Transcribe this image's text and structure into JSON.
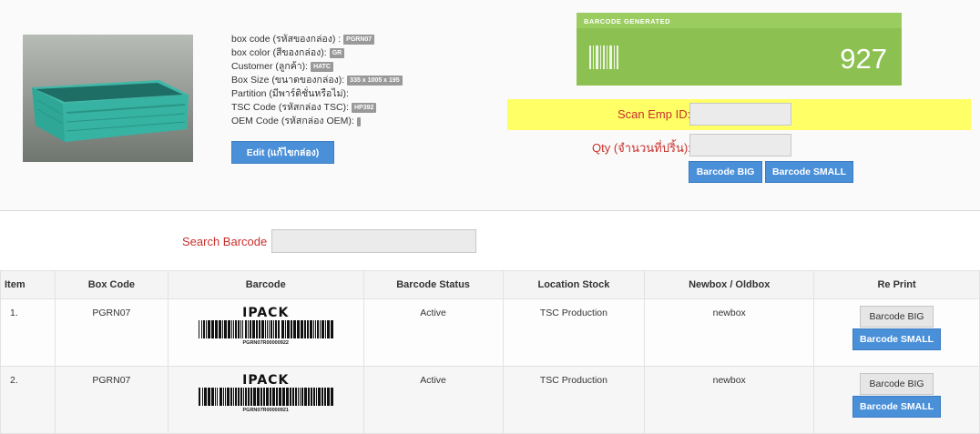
{
  "box_info": {
    "code_label": "box code (รหัสของกล่อง) :",
    "code_value": "PGRN07",
    "color_label": "box color (สีของกล่อง):",
    "color_value": "GR",
    "customer_label": "Customer (ลูกค้า):",
    "customer_value": "HATC",
    "size_label": "Box Size (ขนาดของกล่อง):",
    "size_value": "335 x 1005 x 195",
    "partition_label": "Partition (มีพาร์ติชั่นหรือไม่):",
    "tsc_label": "TSC Code (รหัสกล่อง TSC):",
    "tsc_value": "HP392",
    "oem_label": "OEM Code (รหัสกล่อง OEM):",
    "edit_button": "Edit (แก้ไขกล่อง)"
  },
  "generated": {
    "header": "BARCODE GENERATED",
    "count": "927",
    "icon": "barcode-icon",
    "color": "#8cc152"
  },
  "form": {
    "scan_label": "Scan Emp ID:",
    "qty_label": "Qty (จำนวนที่ปริ้น):",
    "barcode_big": "Barcode BIG",
    "barcode_small": "Barcode SMALL"
  },
  "search": {
    "label": "Search Barcode :"
  },
  "table": {
    "headers": [
      "Item",
      "Box Code",
      "Barcode",
      "Barcode Status",
      "Location Stock",
      "Newbox / Oldbox",
      "Re Print"
    ],
    "rows": [
      {
        "item": "1.",
        "box_code": "PGRN07",
        "barcode_logo": "IPACK",
        "barcode_text": "PGRN07R00000922",
        "status": "Active",
        "location": "TSC Production",
        "newbox": "newbox",
        "reprint_big": "Barcode BIG",
        "reprint_small": "Barcode SMALL"
      },
      {
        "item": "2.",
        "box_code": "PGRN07",
        "barcode_logo": "IPACK",
        "barcode_text": "PGRN07R00000921",
        "status": "Active",
        "location": "TSC Production",
        "newbox": "newbox",
        "reprint_big": "Barcode BIG",
        "reprint_small": "Barcode SMALL"
      }
    ]
  }
}
